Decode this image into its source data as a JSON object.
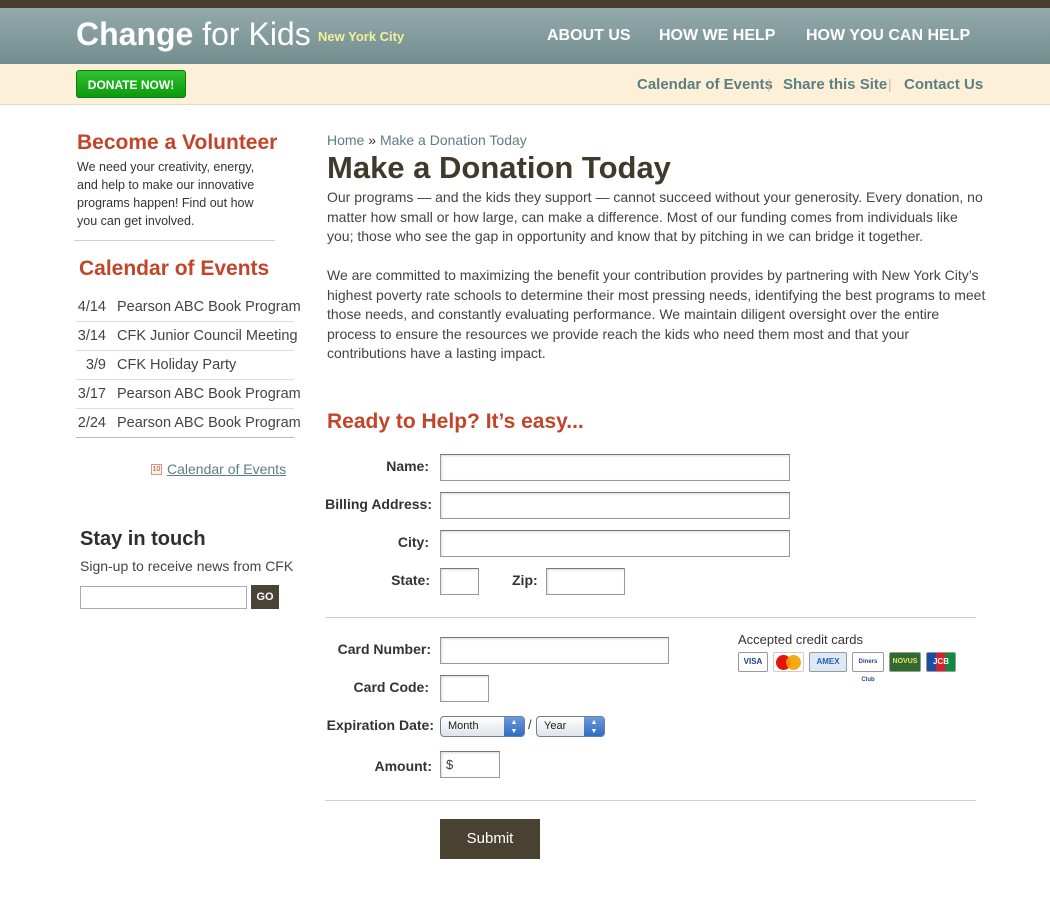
{
  "header": {
    "logo_bold": "Change",
    "logo_light": "for Kids",
    "logo_city": "New York City",
    "nav": [
      "ABOUT US",
      "HOW WE HELP",
      "HOW YOU CAN HELP"
    ]
  },
  "subbar": {
    "donate_label": "DONATE NOW!",
    "links": [
      "Calendar of Events",
      "Share this Site",
      "Contact Us"
    ],
    "separator": "|"
  },
  "sidebar": {
    "volunteer_heading": "Become a Volunteer",
    "volunteer_text": "We need your creativity, energy, and help to make our innovative programs happen! Find out how you can get involved.",
    "calendar_heading": "Calendar of Events",
    "events": [
      {
        "date": "4/14",
        "name": "Pearson ABC Book Program"
      },
      {
        "date": "3/14",
        "name": "CFK Junior Council Meeting"
      },
      {
        "date": "3/9",
        "name": "CFK Holiday Party"
      },
      {
        "date": "3/17",
        "name": "Pearson ABC Book Program"
      },
      {
        "date": "2/24",
        "name": "Pearson ABC Book Program"
      }
    ],
    "calendar_link": "Calendar of Events",
    "calendar_icon_text": "10",
    "stay_heading": "Stay in touch",
    "stay_text": "Sign-up to receive news from CFK",
    "go_label": "GO"
  },
  "main": {
    "breadcrumb_home": "Home",
    "breadcrumb_sep": "»",
    "breadcrumb_current": "Make a Donation Today",
    "title": "Make a Donation Today",
    "para1": "Our programs — and the kids they support — cannot succeed without your generosity. Every donation, no matter how small or how large, can make a difference. Most of our funding comes from individuals like you; those who see the gap in opportunity and know that by pitching in we can bridge it together.",
    "para2": "We are committed to maximizing the benefit your contribution provides by partnering with New York City’s highest poverty rate schools to determine their most pressing needs, identifying the best programs to meet those needs, and constantly evaluating performance. We maintain diligent oversight over the entire process to ensure the resources we provide reach the kids who need them most and that your contributions have a lasting impact.",
    "ready_heading": "Ready to Help? It’s easy..."
  },
  "form": {
    "name_label": "Name:",
    "billing_label": "Billing Address:",
    "city_label": "City:",
    "state_label": "State:",
    "zip_label": "Zip:",
    "card_number_label": "Card Number:",
    "card_code_label": "Card Code:",
    "expiration_label": "Expiration Date:",
    "month_value": "Month",
    "year_value": "Year",
    "slash": "/",
    "amount_label": "Amount:",
    "amount_prefix": "$",
    "accepted_cards_label": "Accepted credit cards",
    "cards": [
      "VISA",
      "MasterCard",
      "AMEX",
      "Diners Club",
      "NOVUS",
      "JCB"
    ],
    "submit_label": "Submit"
  },
  "colors": {
    "header": "#7f9799",
    "accent_red": "#c2452a",
    "link_teal": "#5b7f82",
    "donate_green": "#1aad1a",
    "dark_button": "#494231"
  }
}
